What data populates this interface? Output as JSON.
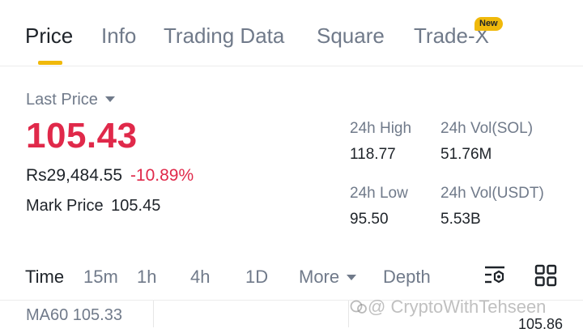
{
  "tabs": [
    {
      "label": "Price",
      "active": true
    },
    {
      "label": "Info"
    },
    {
      "label": "Trading Data"
    },
    {
      "label": "Square"
    },
    {
      "label": "Trade-X",
      "badge": "New"
    }
  ],
  "price": {
    "last_price_label": "Last Price",
    "last_price": "105.43",
    "fiat_value": "Rs29,484.55",
    "change_pct": "-10.89%",
    "mark_price_label": "Mark Price",
    "mark_price": "105.45"
  },
  "stats": {
    "high_label": "24h High",
    "high_value": "118.77",
    "vol_sol_label": "24h Vol(SOL)",
    "vol_sol_value": "51.76M",
    "low_label": "24h Low",
    "low_value": "95.50",
    "vol_usdt_label": "24h Vol(USDT)",
    "vol_usdt_value": "5.53B"
  },
  "chart_tabs": {
    "time": "Time",
    "m15": "15m",
    "h1": "1h",
    "h4": "4h",
    "d1": "1D",
    "more": "More",
    "depth": "Depth"
  },
  "chart": {
    "ma60": "MA60 105.33",
    "right_axis_value": "105.86"
  },
  "watermark": "@ CryptoWithTehseen",
  "colors": {
    "accent": "#f0b90b",
    "down": "#e0294a",
    "text": "#1e2329",
    "muted": "#707a8a"
  },
  "icons": [
    "caret-down-icon",
    "chart-settings-icon",
    "grid-layout-icon",
    "watermark-logo-icon"
  ]
}
